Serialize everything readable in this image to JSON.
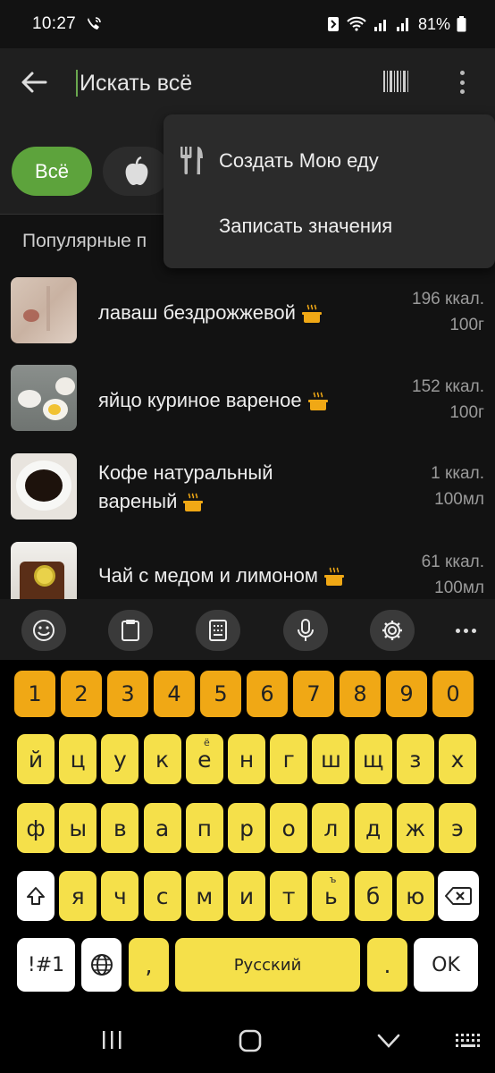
{
  "status": {
    "time": "10:27",
    "battery": "81%"
  },
  "search": {
    "placeholder": "Искать всё"
  },
  "chips": {
    "all": "Всё"
  },
  "section": {
    "popular": "Популярные п"
  },
  "menu": {
    "items": [
      {
        "label": "Создать Мою еду",
        "icon": "fork-knife-icon"
      },
      {
        "label": "Записать значения"
      }
    ]
  },
  "foods": [
    {
      "name": "лаваш бездрожжевой",
      "kcal": "196 ккал.",
      "portion": "100г"
    },
    {
      "name": "яйцо куриное вареное",
      "kcal": "152 ккал.",
      "portion": "100г"
    },
    {
      "name_l1": "Кофе натуральный",
      "name_l2": "вареный",
      "kcal": "1 ккал.",
      "portion": "100мл"
    },
    {
      "name": "Чай с медом и лимоном",
      "kcal": "61 ккал.",
      "portion": "100мл"
    }
  ],
  "keyboard": {
    "numbers": [
      "1",
      "2",
      "3",
      "4",
      "5",
      "6",
      "7",
      "8",
      "9",
      "0"
    ],
    "row1": [
      "й",
      "ц",
      "у",
      "к",
      "е",
      "н",
      "г",
      "ш",
      "щ",
      "з",
      "х"
    ],
    "row1_sup": "ё",
    "row2": [
      "ф",
      "ы",
      "в",
      "а",
      "п",
      "р",
      "о",
      "л",
      "д",
      "ж",
      "э"
    ],
    "row3": [
      "я",
      "ч",
      "с",
      "м",
      "и",
      "т",
      "ь",
      "б",
      "ю"
    ],
    "row3_sup": "ъ",
    "symbols": "!#1",
    "comma": ",",
    "space": "Русский",
    "period": ".",
    "ok": "OK"
  },
  "colors": {
    "accent": "#5da33c",
    "key_yellow": "#f5e04a",
    "key_orange": "#f0a815",
    "pot_orange": "#f0a815"
  }
}
